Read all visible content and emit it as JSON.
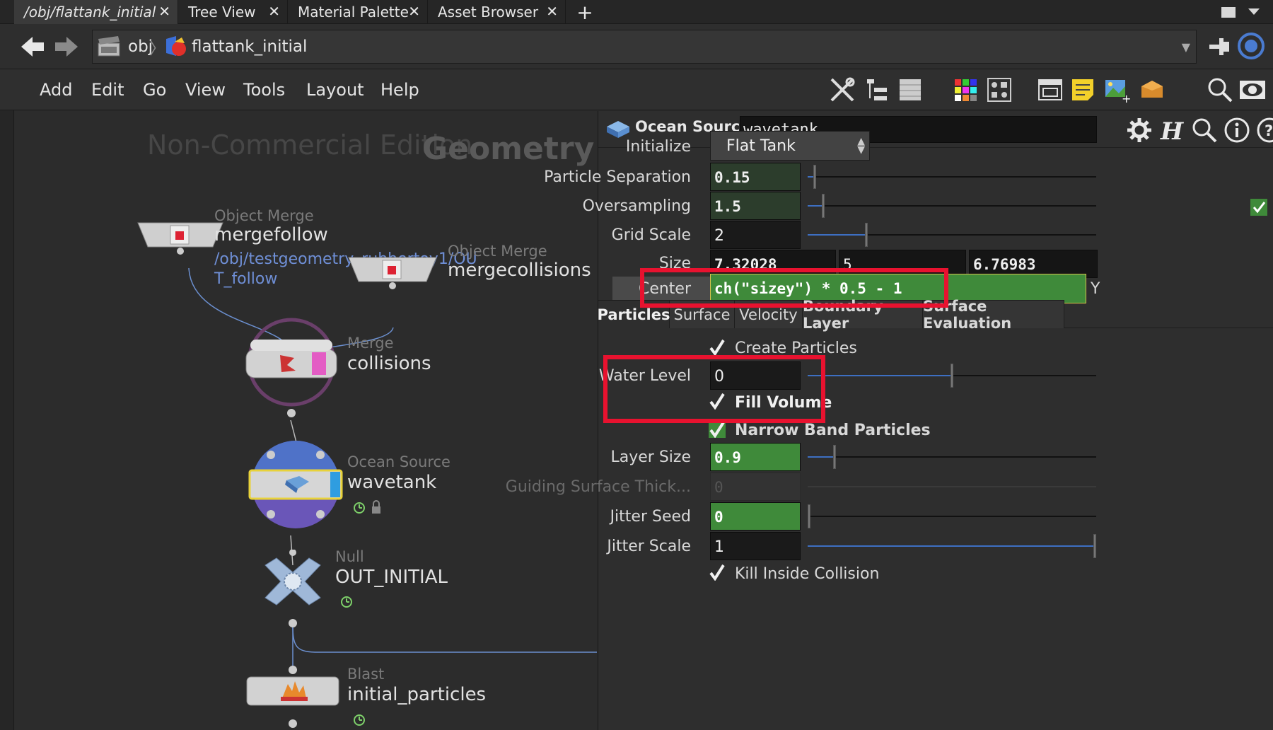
{
  "tabs": [
    {
      "label": "/obj/flattank_initial",
      "active": true
    },
    {
      "label": "Tree View"
    },
    {
      "label": "Material Palette"
    },
    {
      "label": "Asset Browser"
    }
  ],
  "path": {
    "obj": "obj",
    "node": "flattank_initial"
  },
  "menu": [
    "Add",
    "Edit",
    "Go",
    "View",
    "Tools",
    "Layout",
    "Help"
  ],
  "network": {
    "watermark": "Non-Commercial Edition",
    "context": "Geometry",
    "nodes": {
      "mergefollow": {
        "type": "Object Merge",
        "name": "mergefollow",
        "path_line1": "/obj/testgeometry_rubbertoy1/OU",
        "path_line2": "T_follow"
      },
      "mergecollisions": {
        "type": "Object Merge",
        "name": "mergecollisions"
      },
      "collisions": {
        "type": "Merge",
        "name": "collisions"
      },
      "wavetank": {
        "type": "Ocean Source",
        "name": "wavetank"
      },
      "out_initial": {
        "type": "Null",
        "name": "OUT_INITIAL"
      },
      "initial_particles": {
        "type": "Blast",
        "name": "initial_particles"
      }
    }
  },
  "params": {
    "node_type": "Ocean Source",
    "node_name": "wavetank",
    "initialize": {
      "label": "Initialize",
      "value": "Flat Tank"
    },
    "particle_separation": {
      "label": "Particle Separation",
      "value": "0.15",
      "fraction": 0.02
    },
    "oversampling": {
      "label": "Oversampling",
      "value": "1.5",
      "fraction": 0.05
    },
    "grid_scale": {
      "label": "Grid Scale",
      "value": "2",
      "fraction": 0.2
    },
    "size": {
      "label": "Size",
      "x": "7.32028",
      "y": "5",
      "z": "6.76983"
    },
    "center": {
      "label": "Center",
      "expr": "ch(\"sizey\") * 0.5 - 1",
      "axis": "Y"
    },
    "tabs": [
      "Particles",
      "Surface",
      "Velocity",
      "Boundary Layer",
      "Surface Evaluation"
    ],
    "create_particles": "Create Particles",
    "water_level": {
      "label": "Water Level",
      "value": "0",
      "fraction": 0.5
    },
    "fill_volume": "Fill Volume",
    "narrow_band": "Narrow Band Particles",
    "layer_size": {
      "label": "Layer Size",
      "value": "0.9",
      "fraction": 0.09
    },
    "guiding_thickness": {
      "label": "Guiding Surface Thick...",
      "value": "0"
    },
    "jitter_seed": {
      "label": "Jitter Seed",
      "value": "0",
      "fraction": 0.0
    },
    "jitter_scale": {
      "label": "Jitter Scale",
      "value": "1",
      "fraction": 1.0
    },
    "kill_inside": "Kill Inside Collision"
  },
  "colors": {
    "highlight": "#e8122f",
    "selected_node": "#e8d23a",
    "expression": "#3f8a3a"
  }
}
